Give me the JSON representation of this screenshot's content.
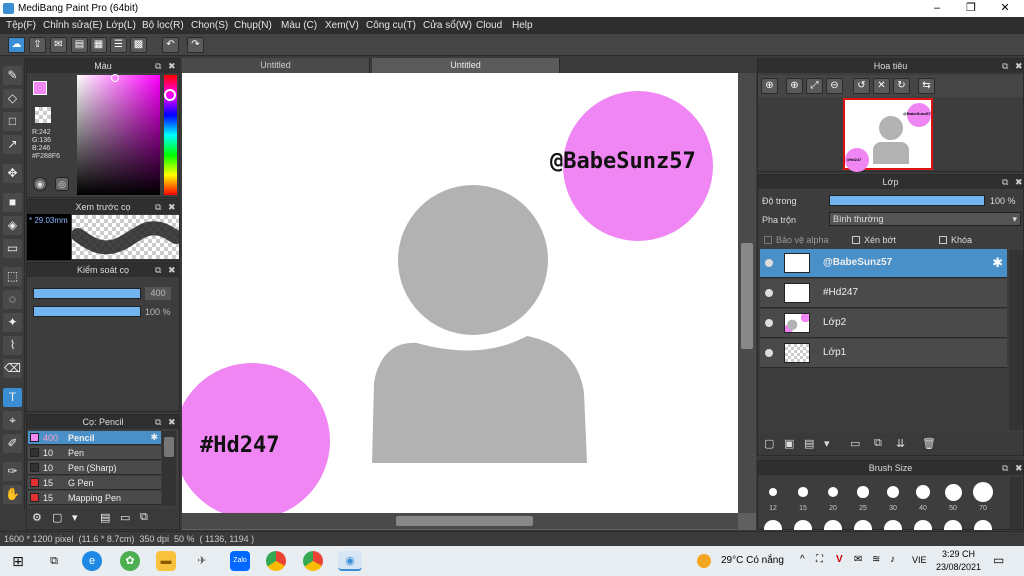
{
  "window": {
    "title": "MediBang Paint Pro (64bit)",
    "minimize": "–",
    "maximize": "❐",
    "close": "✕"
  },
  "menu": [
    "Tệp(F)",
    "Chỉnh sửa(E)",
    "Lớp(L)",
    "Bộ lọc(R)",
    "Chọn(S)",
    "Chụp(N)",
    "Màu (C)",
    "Xem(V)",
    "Công cụ(T)",
    "Cửa sổ(W)",
    "Cloud",
    "Help"
  ],
  "tabs": [
    "Untitled",
    "Untitled"
  ],
  "color_panel": {
    "title": "Màu",
    "r": "R:242",
    "g": "G:136",
    "b": "B:246",
    "hex": "#F288F6",
    "current_color": "#f288f6"
  },
  "brush_preview": {
    "title": "Xem trước cọ",
    "size": "* 29.03mm"
  },
  "brush_control": {
    "title": "Kiểm soát cọ",
    "size_value": "400",
    "opacity_value": "100 %",
    "size_fraction": 1.0,
    "opacity_fraction": 1.0
  },
  "brush_panel": {
    "title": "Cọ: Pencil",
    "items": [
      {
        "size": "400",
        "name": "Pencil",
        "color": "#f288f6",
        "selected": true
      },
      {
        "size": "10",
        "name": "Pen",
        "color": "#333333",
        "selected": false
      },
      {
        "size": "10",
        "name": "Pen (Sharp)",
        "color": "#333333",
        "selected": false
      },
      {
        "size": "15",
        "name": "G Pen",
        "color": "#e03030",
        "selected": false
      },
      {
        "size": "15",
        "name": "Mapping Pen",
        "color": "#e03030",
        "selected": false
      }
    ]
  },
  "canvas": {
    "text1": "@BabeSunz57",
    "text2": "#Hd247",
    "circle_color": "#ef86f3",
    "figure_color": "#b2b2b2"
  },
  "navigator": {
    "title": "Hoa tiêu",
    "thumb_text1": "@BabeSunz57",
    "thumb_text2": "#Hd247"
  },
  "layer_panel": {
    "title": "Lớp",
    "opacity_label": "Độ trong",
    "opacity_value": "100 %",
    "opacity_fraction": 1.0,
    "blend_label": "Pha trộn",
    "blend_value": "Bình thường",
    "protect_alpha": "Bảo vệ alpha",
    "clipping": "Xén bớt",
    "lock": "Khóa",
    "layers": [
      {
        "name": "@BabeSunz57",
        "selected": true
      },
      {
        "name": "#Hd247",
        "selected": false
      },
      {
        "name": "Lớp2",
        "selected": false
      },
      {
        "name": "Lớp1",
        "selected": false
      }
    ]
  },
  "brush_size_panel": {
    "title": "Brush Size",
    "sizes": [
      "12",
      "15",
      "20",
      "25",
      "30",
      "40",
      "50",
      "70"
    ]
  },
  "status": {
    "text": "1600 * 1200 pixel  (11.6 * 8.7cm)  350 dpi  50 %  ( 1136, 1194 )"
  },
  "taskbar": {
    "weather": "29°C  Có nắng",
    "lang": "VIE",
    "time": "3:29 CH",
    "date": "23/08/2021",
    "zalo": "Zalo"
  }
}
